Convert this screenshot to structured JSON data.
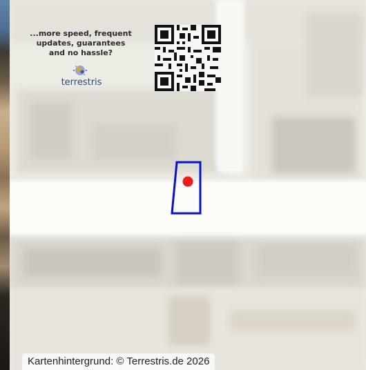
{
  "promo": {
    "lines": [
      "...more speed, frequent",
      "updates, guarantees",
      "and no hassle?"
    ],
    "logo_text": "terrestris",
    "logo_icon": "globe-icon",
    "qr_icon": "qr-code-icon"
  },
  "map": {
    "attribution": "Kartenhintergrund: © Terrestris.de 2026",
    "location_color": "#ee1c1c",
    "boundary_color": "#0a12c8"
  }
}
